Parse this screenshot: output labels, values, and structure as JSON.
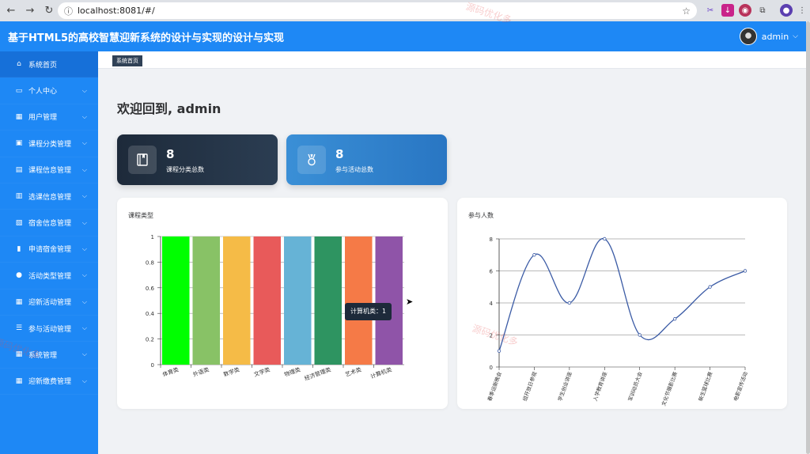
{
  "browser": {
    "url": "localhost:8081/#/"
  },
  "header": {
    "title": "基于HTML5的高校智慧迎新系统的设计与实现的设计与实现",
    "user_name": "admin"
  },
  "tagbar": {
    "tag_label": "系统首页"
  },
  "sidebar": {
    "items": [
      {
        "label": "系统首页",
        "icon": "home-icon",
        "glyph": "⌂",
        "active": true,
        "has_caret": false
      },
      {
        "label": "个人中心",
        "icon": "id-card-icon",
        "glyph": "▭",
        "active": false,
        "has_caret": true
      },
      {
        "label": "用户管理",
        "icon": "grid-icon",
        "glyph": "▦",
        "active": false,
        "has_caret": true
      },
      {
        "label": "课程分类管理",
        "icon": "clipboard-icon",
        "glyph": "▣",
        "active": false,
        "has_caret": true
      },
      {
        "label": "课程信息管理",
        "icon": "briefcase-icon",
        "glyph": "▤",
        "active": false,
        "has_caret": true
      },
      {
        "label": "选课信息管理",
        "icon": "books-icon",
        "glyph": "▥",
        "active": false,
        "has_caret": true
      },
      {
        "label": "宿舍信息管理",
        "icon": "calendar-check-icon",
        "glyph": "▧",
        "active": false,
        "has_caret": true
      },
      {
        "label": "申请宿舍管理",
        "icon": "bar-chart-icon",
        "glyph": "▮",
        "active": false,
        "has_caret": true
      },
      {
        "label": "活动类型管理",
        "icon": "user-icon",
        "glyph": "●",
        "active": false,
        "has_caret": true
      },
      {
        "label": "迎新活动管理",
        "icon": "grid-icon",
        "glyph": "▦",
        "active": false,
        "has_caret": true
      },
      {
        "label": "参与活动管理",
        "icon": "list-icon",
        "glyph": "☰",
        "active": false,
        "has_caret": true
      },
      {
        "label": "系统管理",
        "icon": "grid-icon",
        "glyph": "▦",
        "active": false,
        "has_caret": true
      },
      {
        "label": "迎新缴费管理",
        "icon": "grid-icon",
        "glyph": "▦",
        "active": false,
        "has_caret": true
      }
    ]
  },
  "main": {
    "welcome": "欢迎回到, admin",
    "stats": [
      {
        "value": "8",
        "label": "课程分类总数",
        "icon": "book-icon"
      },
      {
        "value": "8",
        "label": "参与活动总数",
        "icon": "medal-icon"
      }
    ],
    "tooltip": "计算机类：1"
  },
  "watermarks": [
    "源码优化多",
    "源码优化多",
    "源码优化多"
  ],
  "chart_data": [
    {
      "type": "bar",
      "title": "课程类型",
      "categories": [
        "体育类",
        "外语类",
        "数学类",
        "文学类",
        "物理类",
        "经济管理类",
        "艺术类",
        "计算机类"
      ],
      "values": [
        1,
        1,
        1,
        1,
        1,
        1,
        1,
        1
      ],
      "colors": [
        "#00ff00",
        "#88c266",
        "#f5bb47",
        "#e85a5a",
        "#66b3d6",
        "#2e9461",
        "#f57a47",
        "#8f54a8"
      ],
      "ylim": [
        0,
        1
      ],
      "yticks": [
        "0",
        "0.2",
        "0.4",
        "0.6",
        "0.8",
        "1"
      ],
      "grid": true
    },
    {
      "type": "line",
      "title": "参与人数",
      "categories": [
        "春季运新晚会",
        "组开放日参观",
        "学生创业讲座",
        "入学教育讲座",
        "军训动员大会",
        "文化节摄影比赛",
        "新生篮球比赛",
        "电影宣传活动"
      ],
      "values": [
        1,
        7,
        4,
        8,
        2,
        3,
        5,
        6
      ],
      "ylim": [
        0,
        8
      ],
      "yticks": [
        "0",
        "2",
        "4",
        "6",
        "8"
      ],
      "smooth": true,
      "color": "#3b5ba5",
      "grid": true
    }
  ]
}
